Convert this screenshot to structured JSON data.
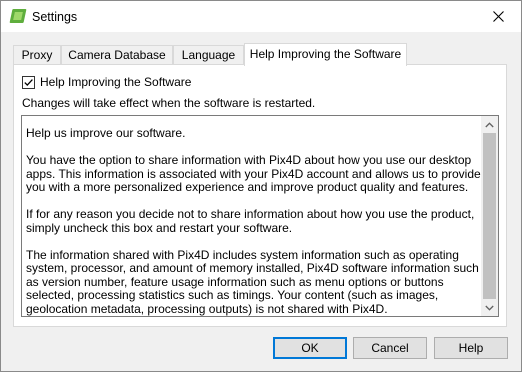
{
  "window": {
    "title": "Settings"
  },
  "tabs": [
    {
      "label": "Proxy"
    },
    {
      "label": "Camera Database"
    },
    {
      "label": "Language"
    },
    {
      "label": "Help Improving the Software",
      "active": true
    }
  ],
  "help_tab": {
    "checkbox_label": "Help Improving the Software",
    "checkbox_checked": true,
    "notice": "Changes will take effect when the software is restarted.",
    "paragraphs": [
      "Help us improve our software.",
      "You have the option to share information with Pix4D about how you use our desktop apps. This information is associated with your Pix4D account and allows us to provide you with a more personalized experience and improve product quality and features.",
      "If for any reason you decide not to share information about how you use the product, simply uncheck this box and restart your software.",
      "The information shared with Pix4D includes system information such as operating system, processor, and amount of memory installed, Pix4D software information such as version number, feature usage information such as menu options or buttons selected, processing statistics such as timings. Your content (such as images, geolocation metadata, processing outputs) is not shared with Pix4D."
    ]
  },
  "buttons": {
    "ok": "OK",
    "cancel": "Cancel",
    "help": "Help"
  },
  "icons": {
    "app": "pix4d-app-icon",
    "close": "close-icon",
    "check": "checkmark-icon",
    "scroll_up": "chevron-up-icon",
    "scroll_down": "chevron-down-icon"
  },
  "colors": {
    "accent": "#0078d7",
    "app_icon": "#5fae3d"
  }
}
